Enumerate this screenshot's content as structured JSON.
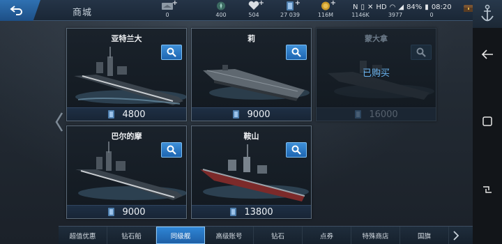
{
  "header": {
    "title": "商城",
    "back_icon": "back-arrow-icon",
    "resources": [
      {
        "icon": "ship-plate-icon",
        "value": "0",
        "plus": true
      },
      {
        "icon": "energy-icon",
        "value": "400",
        "plus": false
      },
      {
        "icon": "heart-icon",
        "value": "504",
        "plus": true
      },
      {
        "icon": "card-icon",
        "value": "27 039",
        "plus": true
      },
      {
        "icon": "gold-coin-icon",
        "value": "116M",
        "plus": true
      },
      {
        "icon": "diamond-icon",
        "value": "1146K",
        "plus": false
      },
      {
        "icon": "medal-icon",
        "value": "3977",
        "plus": false
      },
      {
        "icon": "flag-icon",
        "value": "0",
        "plus": false
      }
    ]
  },
  "status_bar": {
    "battery": "84%",
    "time": "08:20"
  },
  "ships": [
    {
      "name": "亚特兰大",
      "price": "4800",
      "owned": false
    },
    {
      "name": "莉",
      "price": "9000",
      "owned": false
    },
    {
      "name": "蒙大拿",
      "price": "16000",
      "owned": true,
      "owned_label": "已购买"
    },
    {
      "name": "巴尔的摩",
      "price": "9000",
      "owned": false
    },
    {
      "name": "鞍山",
      "price": "13800",
      "owned": false
    }
  ],
  "tabs": [
    {
      "label": "超值优惠",
      "active": false
    },
    {
      "label": "钻石船",
      "active": false
    },
    {
      "label": "同级舰",
      "active": true
    },
    {
      "label": "高级账号",
      "active": false
    },
    {
      "label": "钻石",
      "active": false
    },
    {
      "label": "点券",
      "active": false
    },
    {
      "label": "特殊商店",
      "active": false
    },
    {
      "label": "国旗",
      "active": false
    }
  ],
  "colors": {
    "accent": "#2f86d6",
    "owned_text": "#6ab4f0"
  }
}
